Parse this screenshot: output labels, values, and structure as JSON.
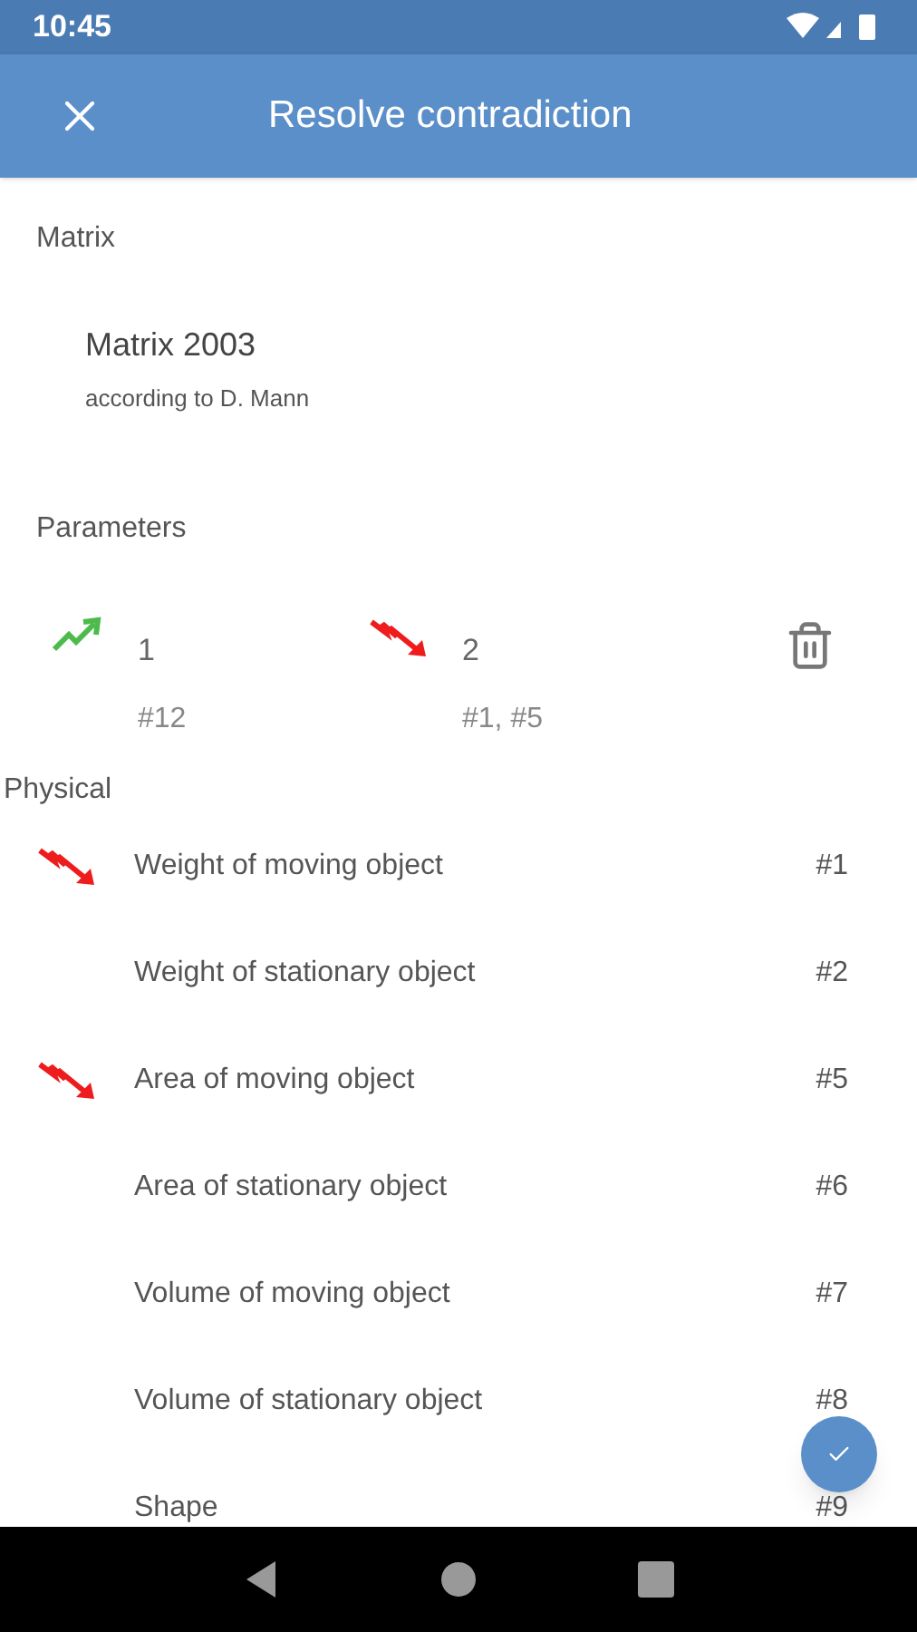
{
  "status_bar": {
    "time": "10:45"
  },
  "app_bar": {
    "title": "Resolve contradiction"
  },
  "matrix": {
    "label": "Matrix",
    "name": "Matrix 2003",
    "subtitle": "according to D. Mann"
  },
  "parameters": {
    "label": "Parameters",
    "items": [
      {
        "kind": "up",
        "number": "1",
        "refs": "#12"
      },
      {
        "kind": "down",
        "number": "2",
        "refs": "#1, #5"
      }
    ]
  },
  "group": {
    "title": "Physical",
    "items": [
      {
        "kind": "down",
        "name": "Weight of moving object",
        "ref": "#1"
      },
      {
        "kind": "none",
        "name": "Weight of stationary object",
        "ref": "#2"
      },
      {
        "kind": "down",
        "name": "Area of moving object",
        "ref": "#5"
      },
      {
        "kind": "none",
        "name": "Area of stationary object",
        "ref": "#6"
      },
      {
        "kind": "none",
        "name": "Volume of moving object",
        "ref": "#7"
      },
      {
        "kind": "none",
        "name": "Volume of stationary object",
        "ref": "#8"
      },
      {
        "kind": "none",
        "name": "Shape",
        "ref": "#9"
      }
    ]
  }
}
